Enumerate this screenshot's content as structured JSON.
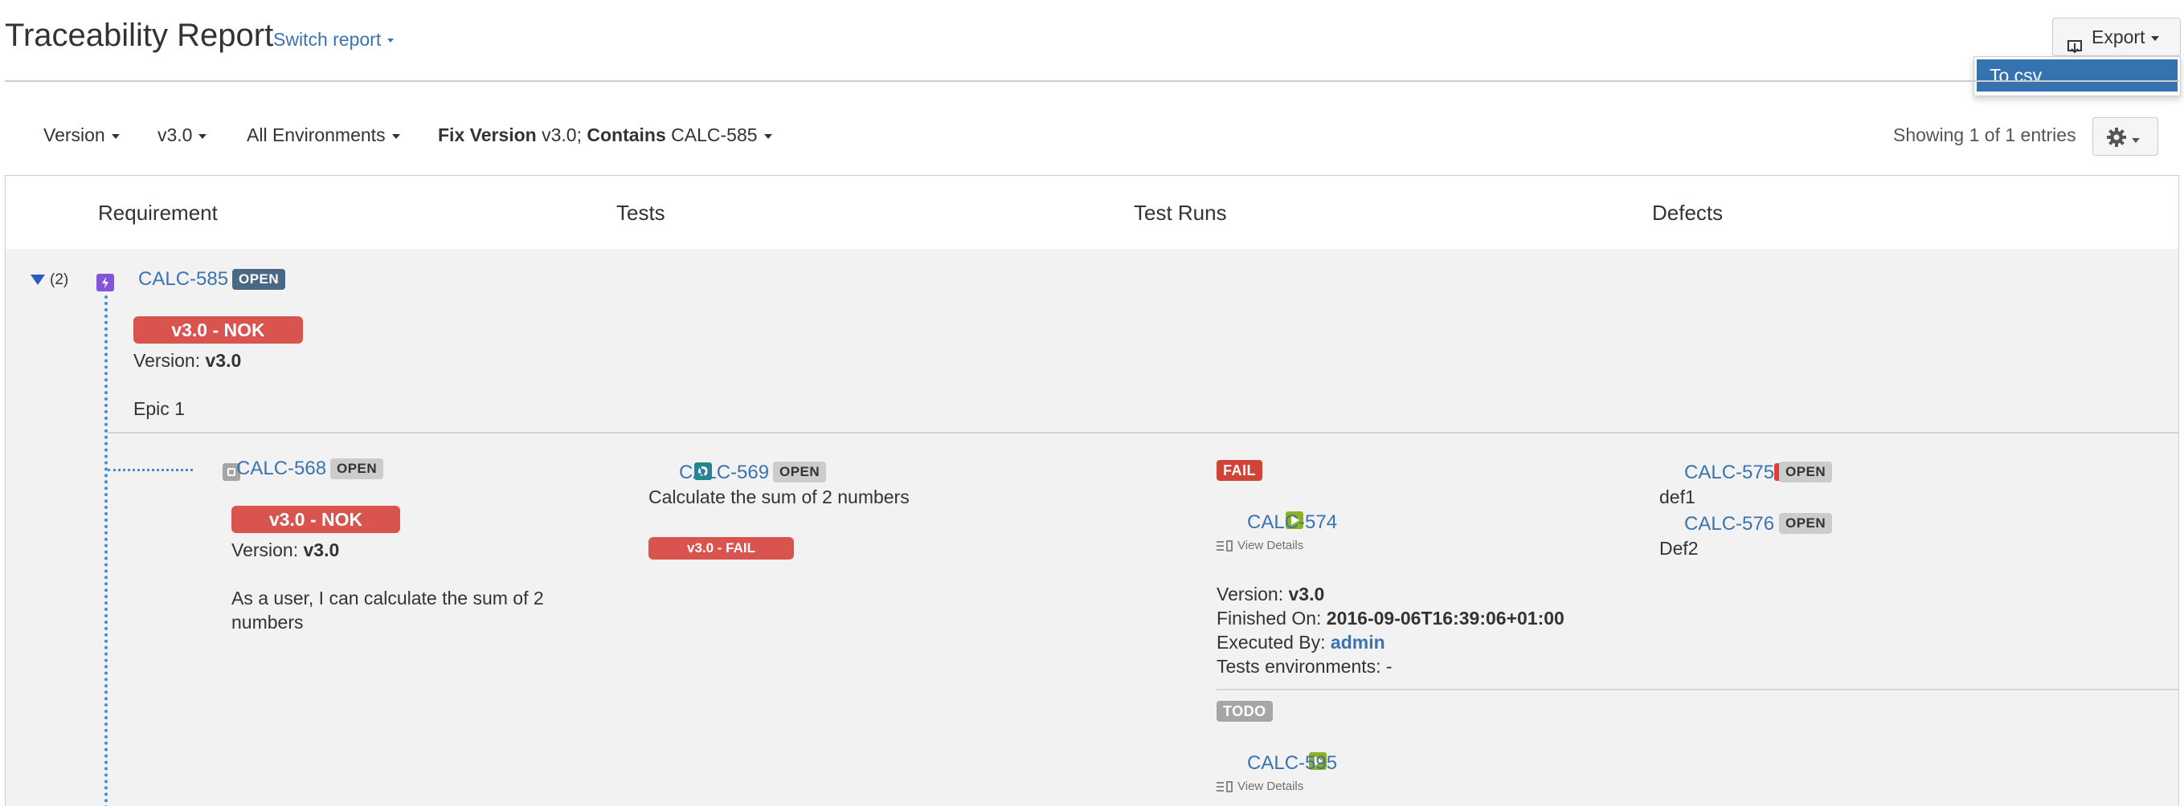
{
  "header": {
    "title": "Traceability Report",
    "switch_report": "Switch report",
    "export_label": "Export",
    "export_menu": [
      "To csv"
    ]
  },
  "filters": {
    "version_label": "Version",
    "version_value": "v3.0",
    "environments": "All Environments",
    "query_fix_version_key": "Fix Version",
    "query_fix_version_val": "v3.0;",
    "query_contains_key": "Contains",
    "query_contains_val": "CALC-585",
    "showing": "Showing 1 of 1 entries"
  },
  "columns": [
    "Requirement",
    "Tests",
    "Test Runs",
    "Defects"
  ],
  "epic": {
    "count": "(2)",
    "key": "CALC-585",
    "status": "OPEN",
    "pill": "v3.0 - NOK",
    "version_label": "Version:",
    "version": "v3.0",
    "summary": "Epic 1"
  },
  "story": {
    "key": "CALC-568",
    "status": "OPEN",
    "pill": "v3.0 - NOK",
    "version_label": "Version:",
    "version": "v3.0",
    "summary": "As a user, I can calculate the sum of 2 numbers"
  },
  "test": {
    "key": "CALC-569",
    "status": "OPEN",
    "summary": "Calculate the sum of 2 numbers",
    "pill": "v3.0 - FAIL"
  },
  "runs": [
    {
      "result": "FAIL",
      "key": "CALC-574",
      "view_details": "View Details",
      "version_label": "Version:",
      "version": "v3.0",
      "finished_label": "Finished On:",
      "finished": "2016-09-06T16:39:06+01:00",
      "executed_label": "Executed By:",
      "executed": "admin",
      "env_label": "Tests environments:",
      "env": "-"
    },
    {
      "result": "TODO",
      "key": "CALC-595",
      "view_details": "View Details"
    }
  ],
  "defects": [
    {
      "key": "CALC-575",
      "status": "OPEN",
      "summary": "def1"
    },
    {
      "key": "CALC-576",
      "status": "OPEN",
      "summary": "Def2"
    }
  ],
  "colors": {
    "link": "#3b73af",
    "nok_red": "#d9534f",
    "open_blue": "#4a6785",
    "epic_purple": "#8654d6",
    "test_teal": "#1f8a8a",
    "run_green": "#8eb021",
    "defect_red": "#e03c3c",
    "dropdown_selected": "#3572b0"
  }
}
